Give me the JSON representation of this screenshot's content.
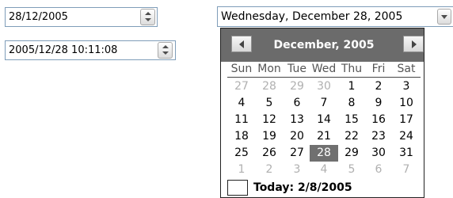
{
  "date_picker": {
    "value": "28/12/2005"
  },
  "datetime_picker": {
    "value": "2005/12/28 10:11:08"
  },
  "long_date_picker": {
    "value": "Wednesday,  December  28, 2005"
  },
  "calendar": {
    "month_title": "December, 2005",
    "weekdays": [
      "Sun",
      "Mon",
      "Tue",
      "Wed",
      "Thu",
      "Fri",
      "Sat"
    ],
    "weeks": [
      [
        "27",
        "28",
        "29",
        "30",
        "1",
        "2",
        "3"
      ],
      [
        "4",
        "5",
        "6",
        "7",
        "8",
        "9",
        "10"
      ],
      [
        "11",
        "12",
        "13",
        "14",
        "15",
        "16",
        "17"
      ],
      [
        "18",
        "19",
        "20",
        "21",
        "22",
        "23",
        "24"
      ],
      [
        "25",
        "26",
        "27",
        "28",
        "29",
        "30",
        "31"
      ],
      [
        "1",
        "2",
        "3",
        "4",
        "5",
        "6",
        "7"
      ]
    ],
    "other_month_cells": [
      [
        0,
        0
      ],
      [
        0,
        1
      ],
      [
        0,
        2
      ],
      [
        0,
        3
      ],
      [
        5,
        0
      ],
      [
        5,
        1
      ],
      [
        5,
        2
      ],
      [
        5,
        3
      ],
      [
        5,
        4
      ],
      [
        5,
        5
      ],
      [
        5,
        6
      ]
    ],
    "selected_cell": [
      4,
      3
    ],
    "today_label": "Today: 2/8/2005",
    "colors": {
      "header": "#6b6b6b",
      "selected": "#707070",
      "other_month": "#b0b0b0"
    }
  }
}
